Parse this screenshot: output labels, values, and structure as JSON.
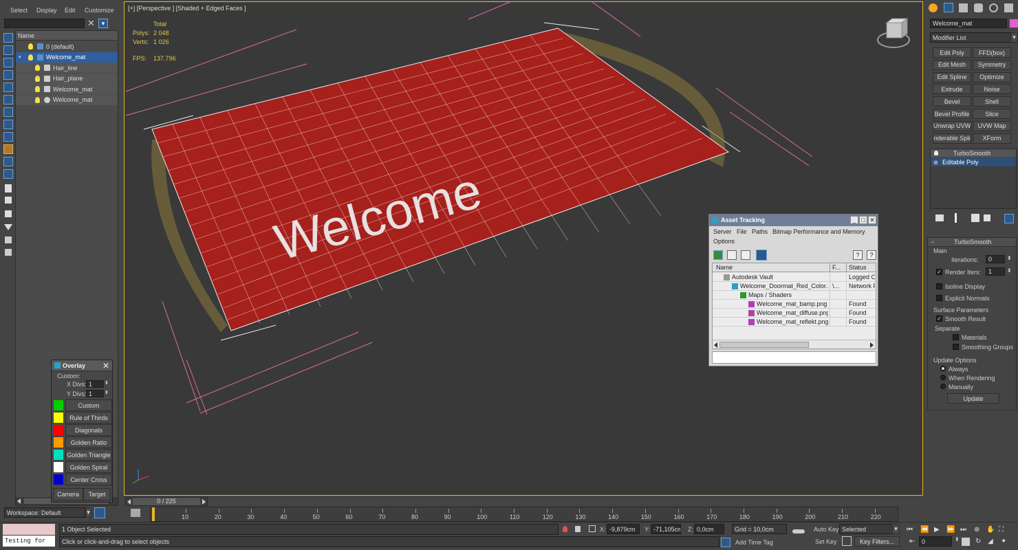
{
  "top_menu": [
    "Select",
    "Display",
    "Edit",
    "Customize"
  ],
  "scene_explorer": {
    "layers": [
      {
        "label": "0 (default)",
        "indent": 0,
        "selected": false
      },
      {
        "label": "Welcome_mat",
        "indent": 0,
        "selected": true
      },
      {
        "label": "Hair_line",
        "indent": 1,
        "selected": false
      },
      {
        "label": "Hair_plane",
        "indent": 1,
        "selected": false
      },
      {
        "label": "Welcome_mat",
        "indent": 1,
        "selected": false
      },
      {
        "label": "Welcome_mat",
        "indent": 1,
        "selected": false
      }
    ],
    "name_header": "Name",
    "workspace": "Workspace: Default"
  },
  "viewport": {
    "label": "[+] [Perspective ] [Shaded + Edged Faces ]",
    "stats": {
      "total_label": "Total",
      "polys_label": "Polys:",
      "polys": "2 048",
      "verts_label": "Verts:",
      "verts": "1 026",
      "fps_label": "FPS:",
      "fps": "137.796"
    },
    "mat_text": "Welcome",
    "mat_color": "#a6201c"
  },
  "overlay": {
    "title": "Overlay",
    "custom_label": "Custom:",
    "xdivs_label": "X Divs:",
    "xdivs": "1",
    "ydivs_label": "Y Divs:",
    "ydivs": "1",
    "items": [
      {
        "label": "Custom",
        "color": "#00d000"
      },
      {
        "label": "Rule of Thirds",
        "color": "#ffff00"
      },
      {
        "label": "Diagonals",
        "color": "#ff0000"
      },
      {
        "label": "Golden Ratio",
        "color": "#ff9900"
      },
      {
        "label": "Golden Triangle",
        "color": "#00e0c0"
      },
      {
        "label": "Golden Spiral",
        "color": "#ffffff"
      },
      {
        "label": "Center Cross",
        "color": "#0000cc"
      }
    ],
    "camera": "Camera",
    "target": "Target"
  },
  "asset_tracking": {
    "title": "Asset Tracking",
    "menu": [
      "Server",
      "File",
      "Paths",
      "Bitmap Performance and Memory"
    ],
    "menu2": "Options",
    "col_name": "Name",
    "col_f": "F...",
    "col_status": "Status",
    "rows": [
      {
        "name": "Autodesk Vault",
        "f": "",
        "status": "Logged Ou",
        "indent": 1
      },
      {
        "name": "Welcome_Doormat_Red_Color...",
        "f": "\\...",
        "status": "Network P",
        "indent": 2
      },
      {
        "name": "Maps / Shaders",
        "f": "",
        "status": "",
        "indent": 3
      },
      {
        "name": "Welcome_mat_bamp.png",
        "f": "",
        "status": "Found",
        "indent": 4
      },
      {
        "name": "Welcome_mat_diffuse.png",
        "f": "",
        "status": "Found",
        "indent": 4
      },
      {
        "name": "Welcome_mat_reflekt.png",
        "f": "",
        "status": "Found",
        "indent": 4
      }
    ]
  },
  "command_panel": {
    "object_name": "Welcome_mat",
    "modifier_list": "Modifier List",
    "modifier_buttons": [
      [
        "Edit Poly",
        "FFD(box)"
      ],
      [
        "Edit Mesh",
        "Symmetry"
      ],
      [
        "Edit Spline",
        "Optimize"
      ],
      [
        "Extrude",
        "Noise"
      ],
      [
        "Bevel",
        "Shell"
      ],
      [
        "Bevel Profile",
        "Slice"
      ],
      [
        "Unwrap UVW",
        "UVW Map"
      ],
      [
        "enderable Splin",
        "XForm"
      ]
    ],
    "stack": [
      "TurboSmooth",
      "Editable Poly"
    ],
    "rollout_title": "TurboSmooth",
    "main_label": "Main",
    "iterations_label": "Iterations:",
    "iterations": "0",
    "render_iters_label": "Render Iters:",
    "render_iters": "1",
    "isoline": "Isoline Display",
    "explicit": "Explicit Normals",
    "surface_label": "Surface Parameters",
    "smooth_result": "Smooth Result",
    "separate_label": "Separate",
    "materials": "Materials",
    "smoothing_groups": "Smoothing Groups",
    "update_label": "Update Options",
    "always": "Always",
    "when_rendering": "When Rendering",
    "manually": "Manually",
    "update_btn": "Update"
  },
  "timeline": {
    "frame_readout": "0 / 225",
    "ticks": [
      "10",
      "20",
      "30",
      "40",
      "50",
      "60",
      "70",
      "80",
      "90",
      "100",
      "110",
      "120",
      "130",
      "140",
      "150",
      "160",
      "170",
      "180",
      "190",
      "200",
      "210",
      "220"
    ]
  },
  "status": {
    "script": "Testing for",
    "objects": "1 Object Selected",
    "hint": "Click or click-and-drag to select objects",
    "x_label": "X:",
    "x": "-9,879cm",
    "y_label": "Y:",
    "y": "-71,105cm",
    "z_label": "Z:",
    "z": "0,0cm",
    "grid": "Grid = 10,0cm",
    "add_time_tag": "Add Time Tag",
    "auto_key": "Auto Key",
    "selected": "Selected",
    "set_key": "Set Key",
    "key_filters": "Key Filters...",
    "frame": "0"
  }
}
